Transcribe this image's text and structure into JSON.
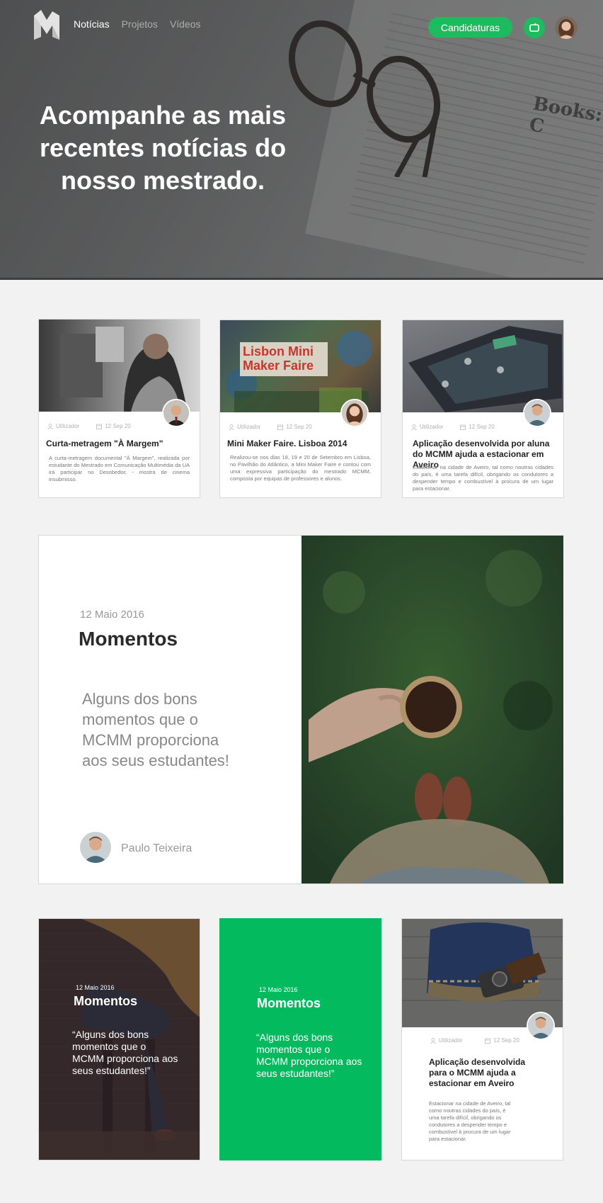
{
  "header": {
    "nav": [
      "Notícias",
      "Projetos",
      "Vídeos"
    ],
    "cta": "Candidaturas",
    "hero_title": "Acompanhe as mais recentes notícias do nosso mestrado.",
    "hero_books": "Books: C"
  },
  "cards": [
    {
      "author": "Utilizador",
      "date": "12 Sep 20",
      "title": "Curta-metragem \"À Margem\"",
      "text": "A curta-metragem documental \"À Margem\", realizada por estudante do Mestrado em Comunicação Multimédia da UA irá participar no Desobedoc - mostra de cinema insubmisso."
    },
    {
      "author": "Utilizador",
      "date": "12 Sep 20",
      "title": "Mini Maker Faire. Lisboa 2014",
      "text": "Realizou-se nos dias 18, 19 e 20 de Setembro em Lisboa, no Pavilhão do Atlântico, a Mini Maker Faire e contou com uma expressiva participação do mestrado MCMM, composta por equipas de professores e alunos.",
      "sign_line1": "Lisbon Mini",
      "sign_line2": "Maker Faire"
    },
    {
      "author": "Utilizador",
      "date": "12 Sep 20",
      "title": "Aplicação desenvolvida por aluna do MCMM ajuda a estacionar em Aveiro",
      "text": "Estacionar na cidade de Aveiro, tal como noutras cidades do país, é uma tarefa difícil, obrigando os condutores a despender tempo e combustível à procura de um lugar para estacionar."
    }
  ],
  "feature": {
    "date": "12 Maio 2016",
    "title": "Momentos",
    "text": "Alguns dos bons momentos que o MCMM proporciona aos seus estudantes!",
    "author": "Paulo Teixeira"
  },
  "tiles": [
    {
      "date": "12 Maio 2016",
      "title": "Momentos",
      "quote": "“Alguns dos bons momentos que o MCMM proporciona aos seus estudantes!”"
    },
    {
      "date": "12 Maio 2016",
      "title": "Momentos",
      "quote": "“Alguns dos bons momentos que o MCMM proporciona aos seus estudantes!”"
    },
    {
      "author": "Utilizador",
      "date": "12 Sep 20",
      "title": "Aplicação desenvolvida para o MCMM ajuda a estacionar em Aveiro",
      "text": "Estacionar na cidade de Aveiro, tal como noutras cidades do país, é uma tarefa difícil, obrigando os condutores a despender tempo e combustível à procura de um lugar para estacionar."
    }
  ],
  "colors": {
    "accent": "#1cbc5e",
    "background": "#f2f2f2"
  },
  "icons": [
    "logo-icon",
    "tv-icon",
    "user-icon",
    "calendar-icon"
  ]
}
